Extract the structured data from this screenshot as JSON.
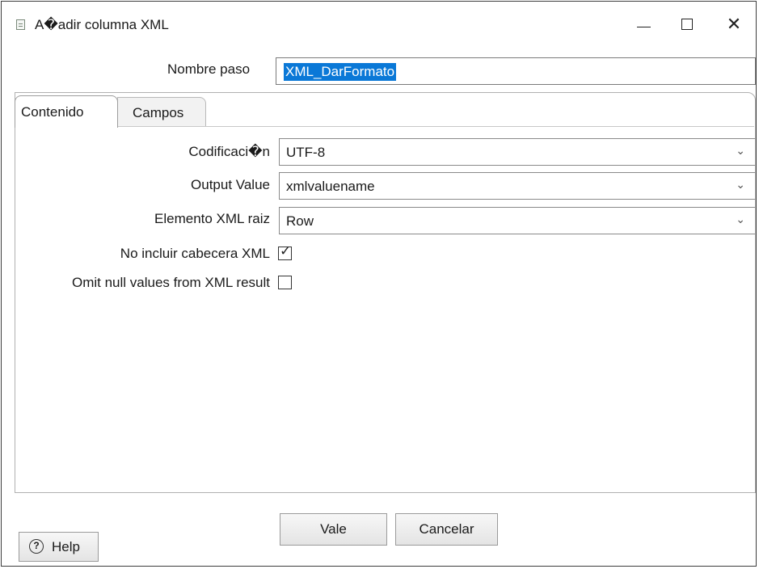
{
  "window": {
    "title": "A�adir columna XML",
    "icon": "document-icon",
    "controls": {
      "minimize": "minimize-icon",
      "maximize": "maximize-icon",
      "close": "✕"
    }
  },
  "step": {
    "label": "Nombre paso",
    "value": "XML_DarFormato"
  },
  "tabs": [
    {
      "label": "Contenido",
      "active": true
    },
    {
      "label": "Campos",
      "active": false
    }
  ],
  "content": {
    "encoding": {
      "label": "Codificaci�n",
      "value": "UTF-8"
    },
    "output_value": {
      "label": "Output Value",
      "value": "xmlvaluename"
    },
    "root_element": {
      "label": "Elemento XML raiz",
      "value": "Row"
    },
    "omit_header": {
      "label": "No incluir cabecera XML",
      "checked": true
    },
    "omit_nulls": {
      "label": "Omit null values from XML result",
      "checked": false
    }
  },
  "buttons": {
    "ok": "Vale",
    "cancel": "Cancelar",
    "help": "Help",
    "help_icon": "?"
  },
  "colors": {
    "selection": "#0a78d7",
    "border": "#8a8a8a"
  }
}
